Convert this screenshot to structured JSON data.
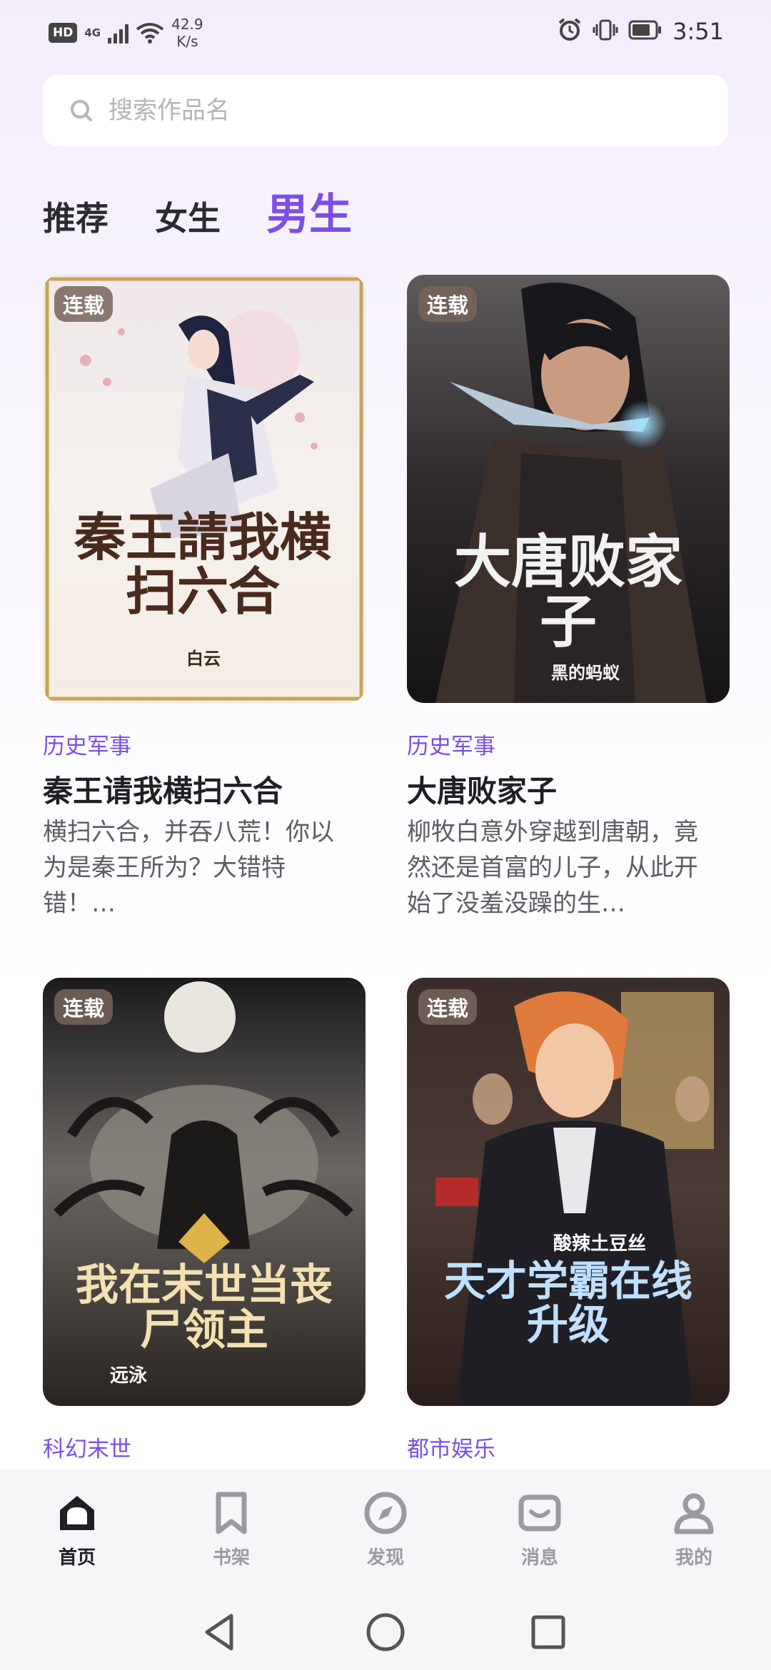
{
  "status_bar": {
    "hd": "HD",
    "network": "4G",
    "speed_value": "42.9",
    "speed_unit": "K/s",
    "time": "3:51"
  },
  "search": {
    "placeholder": "搜索作品名",
    "value": ""
  },
  "tabs": [
    {
      "label": "推荐",
      "active": false
    },
    {
      "label": "女生",
      "active": false
    },
    {
      "label": "男生",
      "active": true
    }
  ],
  "books": [
    {
      "badge": "连载",
      "genre": "历史军事",
      "title": "秦王请我横扫六合",
      "description": "横扫六合，并吞八荒！你以为是秦王所为？大错特错！…",
      "cover_title": "秦王請我横扫六合",
      "cover_author": "白云"
    },
    {
      "badge": "连载",
      "genre": "历史军事",
      "title": "大唐败家子",
      "description": "柳牧白意外穿越到唐朝，竟然还是首富的儿子，从此开始了没羞没躁的生…",
      "cover_title": "大唐败家子",
      "cover_author": "黑的蚂蚁"
    },
    {
      "badge": "连载",
      "genre": "科幻末世",
      "title": "",
      "description": "",
      "cover_title": "我在末世当丧尸领主",
      "cover_author": "远泳"
    },
    {
      "badge": "连载",
      "genre": "都市娱乐",
      "title": "",
      "description": "",
      "cover_title": "天才学霸在线升级",
      "cover_author": "酸辣土豆丝"
    }
  ],
  "bottom_nav": [
    {
      "label": "首页",
      "icon": "home-icon",
      "active": true
    },
    {
      "label": "书架",
      "icon": "bookmark-icon",
      "active": false
    },
    {
      "label": "发现",
      "icon": "compass-icon",
      "active": false
    },
    {
      "label": "消息",
      "icon": "message-icon",
      "active": false
    },
    {
      "label": "我的",
      "icon": "profile-icon",
      "active": false
    }
  ],
  "colors": {
    "accent": "#7b4fe3",
    "text": "#1f1f24",
    "muted": "#9a9aa2"
  }
}
